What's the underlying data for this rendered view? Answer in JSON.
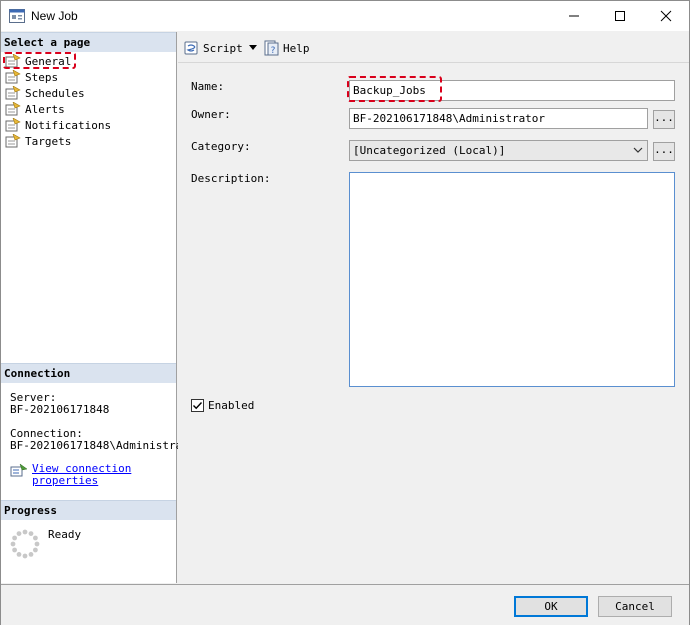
{
  "window": {
    "title": "New Job"
  },
  "left_panel": {
    "select_page_header": "Select a page",
    "pages": [
      "General",
      "Steps",
      "Schedules",
      "Alerts",
      "Notifications",
      "Targets"
    ],
    "connection_header": "Connection",
    "server_label": "Server:",
    "server_value": "BF-202106171848",
    "connection_label": "Connection:",
    "connection_value": "BF-202106171848\\Administrat",
    "view_link_line1": "View connection",
    "view_link_line2": "properties",
    "progress_header": "Progress",
    "progress_status": "Ready"
  },
  "toolbar": {
    "script_label": "Script",
    "help_label": "Help"
  },
  "form": {
    "name_label": "Name:",
    "name_value": "Backup_Jobs",
    "owner_label": "Owner:",
    "owner_value": "BF-202106171848\\Administrator",
    "category_label": "Category:",
    "category_value": "[Uncategorized (Local)]",
    "description_label": "Description:",
    "description_value": "",
    "enabled_label": "Enabled",
    "enabled_checked": true,
    "browse_label": "..."
  },
  "footer": {
    "ok_label": "OK",
    "cancel_label": "Cancel"
  },
  "colors": {
    "highlight": "#d9001b",
    "header_bg": "#dae3ef",
    "default_button": "#0078d7"
  }
}
